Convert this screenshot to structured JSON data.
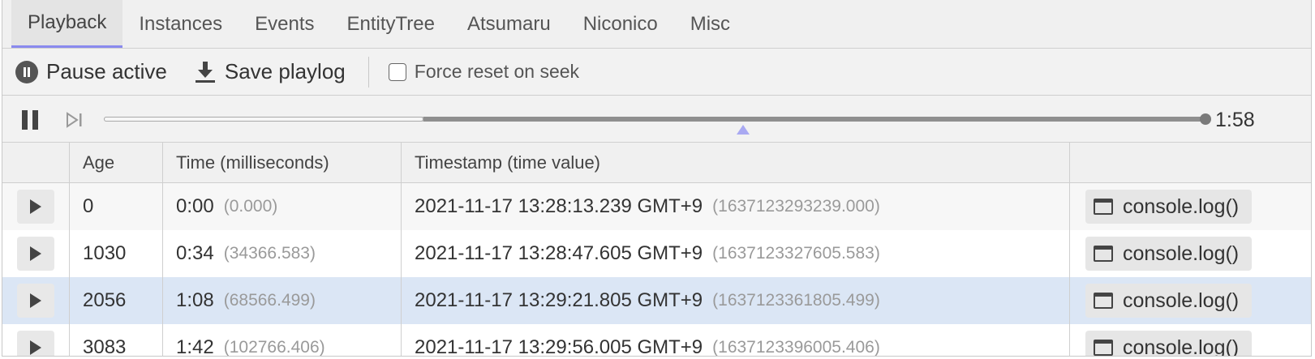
{
  "tabs": [
    {
      "label": "Playback",
      "active": true
    },
    {
      "label": "Instances"
    },
    {
      "label": "Events"
    },
    {
      "label": "EntityTree"
    },
    {
      "label": "Atsumaru"
    },
    {
      "label": "Niconico"
    },
    {
      "label": "Misc"
    }
  ],
  "toolbar": {
    "pause_label": "Pause active",
    "save_label": "Save playlog",
    "force_reset_label": "Force reset on seek",
    "force_reset_checked": false
  },
  "playback": {
    "duration": "1:58",
    "buffered_fraction": 0.29,
    "position_fraction": 1.0,
    "marker_fraction": 0.58,
    "accent_color": "#8a8aee"
  },
  "table": {
    "headers": [
      "",
      "Age",
      "Time (milliseconds)",
      "Timestamp (time value)",
      ""
    ],
    "rows": [
      {
        "age": "0",
        "time": "0:00",
        "time_ms": "(0.000)",
        "timestamp": "2021-11-17 13:28:13.239 GMT+9",
        "time_value": "(1637123293239.000)",
        "action": "console.log()"
      },
      {
        "age": "1030",
        "time": "0:34",
        "time_ms": "(34366.583)",
        "timestamp": "2021-11-17 13:28:47.605 GMT+9",
        "time_value": "(1637123327605.583)",
        "action": "console.log()"
      },
      {
        "age": "2056",
        "time": "1:08",
        "time_ms": "(68566.499)",
        "timestamp": "2021-11-17 13:29:21.805 GMT+9",
        "time_value": "(1637123361805.499)",
        "action": "console.log()",
        "selected": true
      },
      {
        "age": "3083",
        "time": "1:42",
        "time_ms": "(102766.406)",
        "timestamp": "2021-11-17 13:29:56.005 GMT+9",
        "time_value": "(1637123396005.406)",
        "action": "console.log()"
      }
    ]
  }
}
